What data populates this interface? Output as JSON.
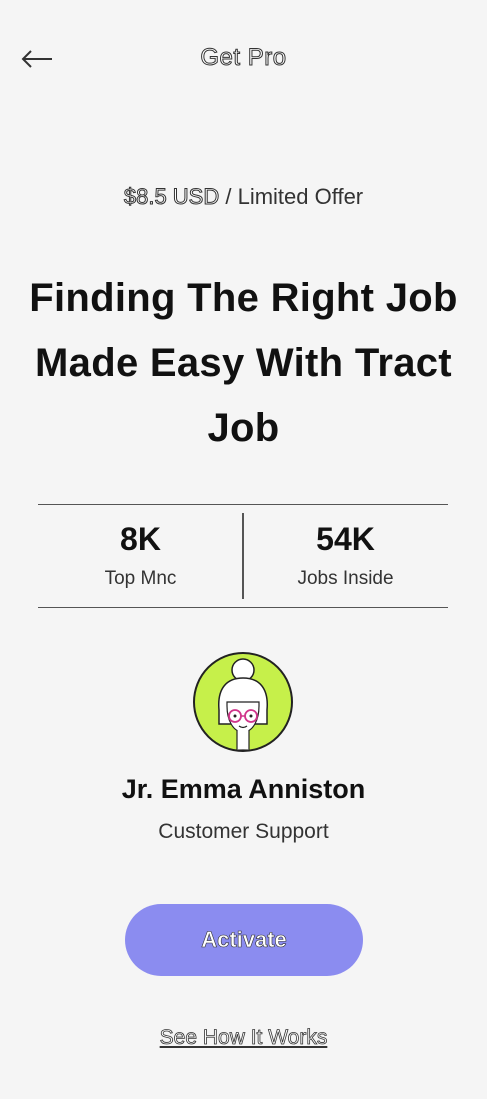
{
  "header": {
    "title": "Get Pro",
    "back_icon": "arrow-left-icon"
  },
  "offer": {
    "price": "$8.5 USD",
    "separator": " / ",
    "label": "Limited Offer"
  },
  "headline": "Finding The Right Job Made Easy With Tract Job",
  "stats": [
    {
      "value": "8K",
      "label": "Top Mnc"
    },
    {
      "value": "54K",
      "label": "Jobs Inside"
    }
  ],
  "support": {
    "name": "Jr. Emma Anniston",
    "role": "Customer Support",
    "avatar_bg": "#c6f04a"
  },
  "actions": {
    "activate_label": "Activate",
    "activate_color": "#8b8cf0",
    "how_it_works_label": "See How It Works"
  }
}
